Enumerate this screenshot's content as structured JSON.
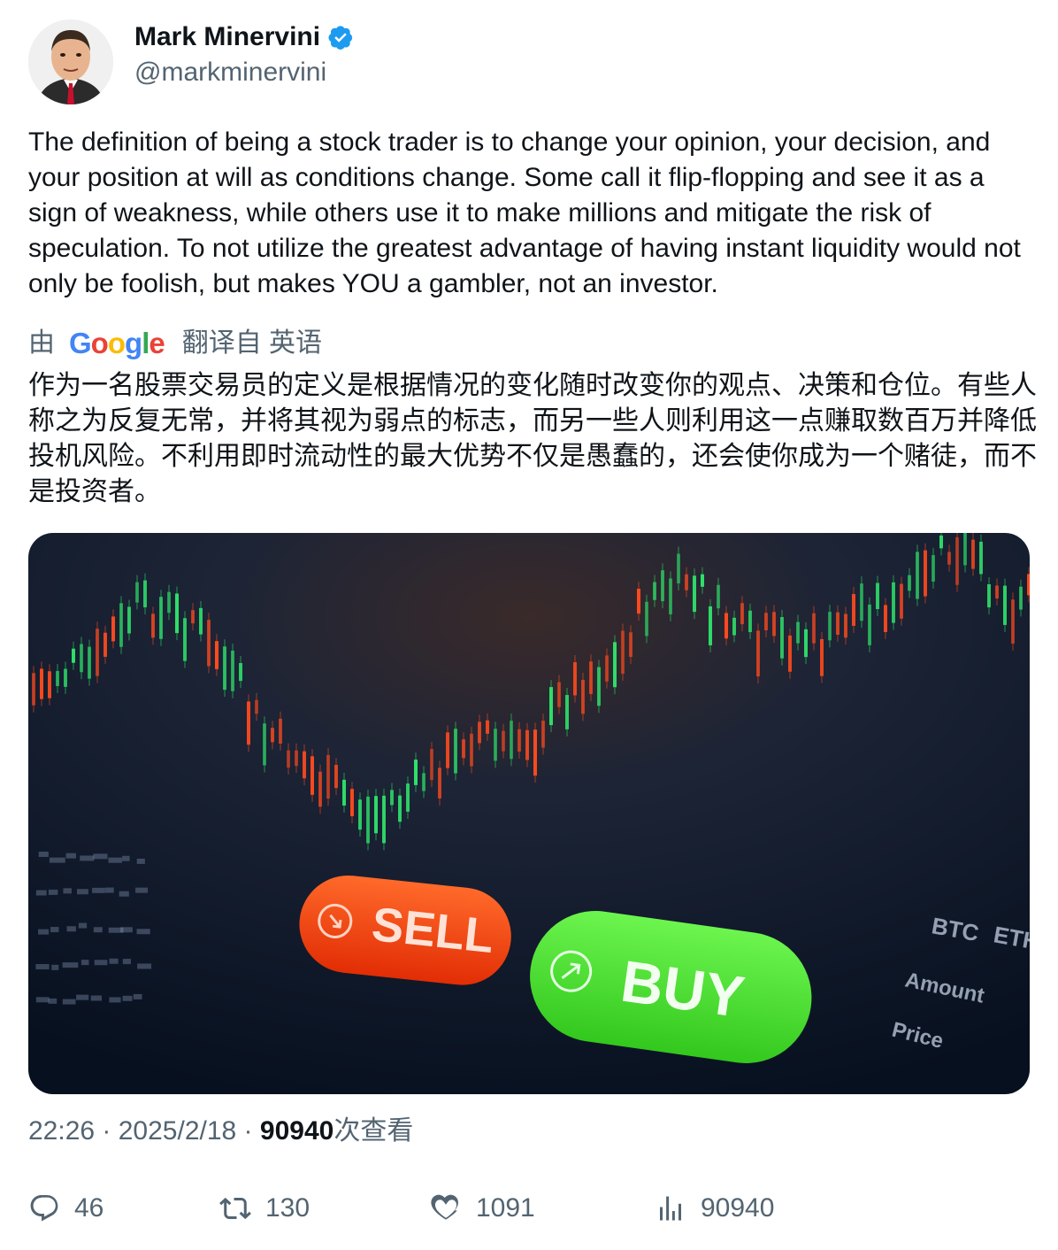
{
  "author": {
    "display_name": "Mark Minervini",
    "handle": "@markminervini",
    "verified_icon": "verified-badge-icon",
    "avatar_icon": "avatar-caricature"
  },
  "tweet": {
    "text": "The definition of being a stock trader is to change your opinion, your decision, and your position at will as conditions change. Some call it flip-flopping and see it as a sign of weakness, while others use it to make millions and mitigate the risk of speculation. To not utilize the greatest advantage of having instant liquidity would not only be foolish, but makes YOU a gambler, not an investor.",
    "translation": {
      "prefix": "由",
      "provider": "Google",
      "suffix": "翻译自 英语",
      "text": "作为一名股票交易员的定义是根据情况的变化随时改变你的观点、决策和仓位。有些人称之为反复无常，并将其视为弱点的标志，而另一些人则利用这一点赚取数百万并降低投机风险。不利用即时流动性的最大优势不仅是愚蠢的，还会使你成为一个赌徒，而不是投资者。"
    }
  },
  "media": {
    "sell_label": "SELL",
    "buy_label": "BUY",
    "side_labels": [
      "BTC",
      "ETH",
      "Amount",
      "Price"
    ],
    "colors": {
      "sell": "#ff4a12",
      "buy": "#4fe83a",
      "background": "#0c1a2e"
    }
  },
  "meta": {
    "time": "22:26",
    "separator": " · ",
    "date": "2025/2/18",
    "views_count": "90940",
    "views_suffix": "次查看"
  },
  "actions": {
    "reply": {
      "count": "46",
      "icon": "reply-icon"
    },
    "retweet": {
      "count": "130",
      "icon": "retweet-icon"
    },
    "like": {
      "count": "1091",
      "icon": "like-icon"
    },
    "views": {
      "count": "90940",
      "icon": "views-icon"
    }
  },
  "colors": {
    "text": "#0f1419",
    "secondary": "#536471",
    "verified": "#1d9bf0"
  }
}
